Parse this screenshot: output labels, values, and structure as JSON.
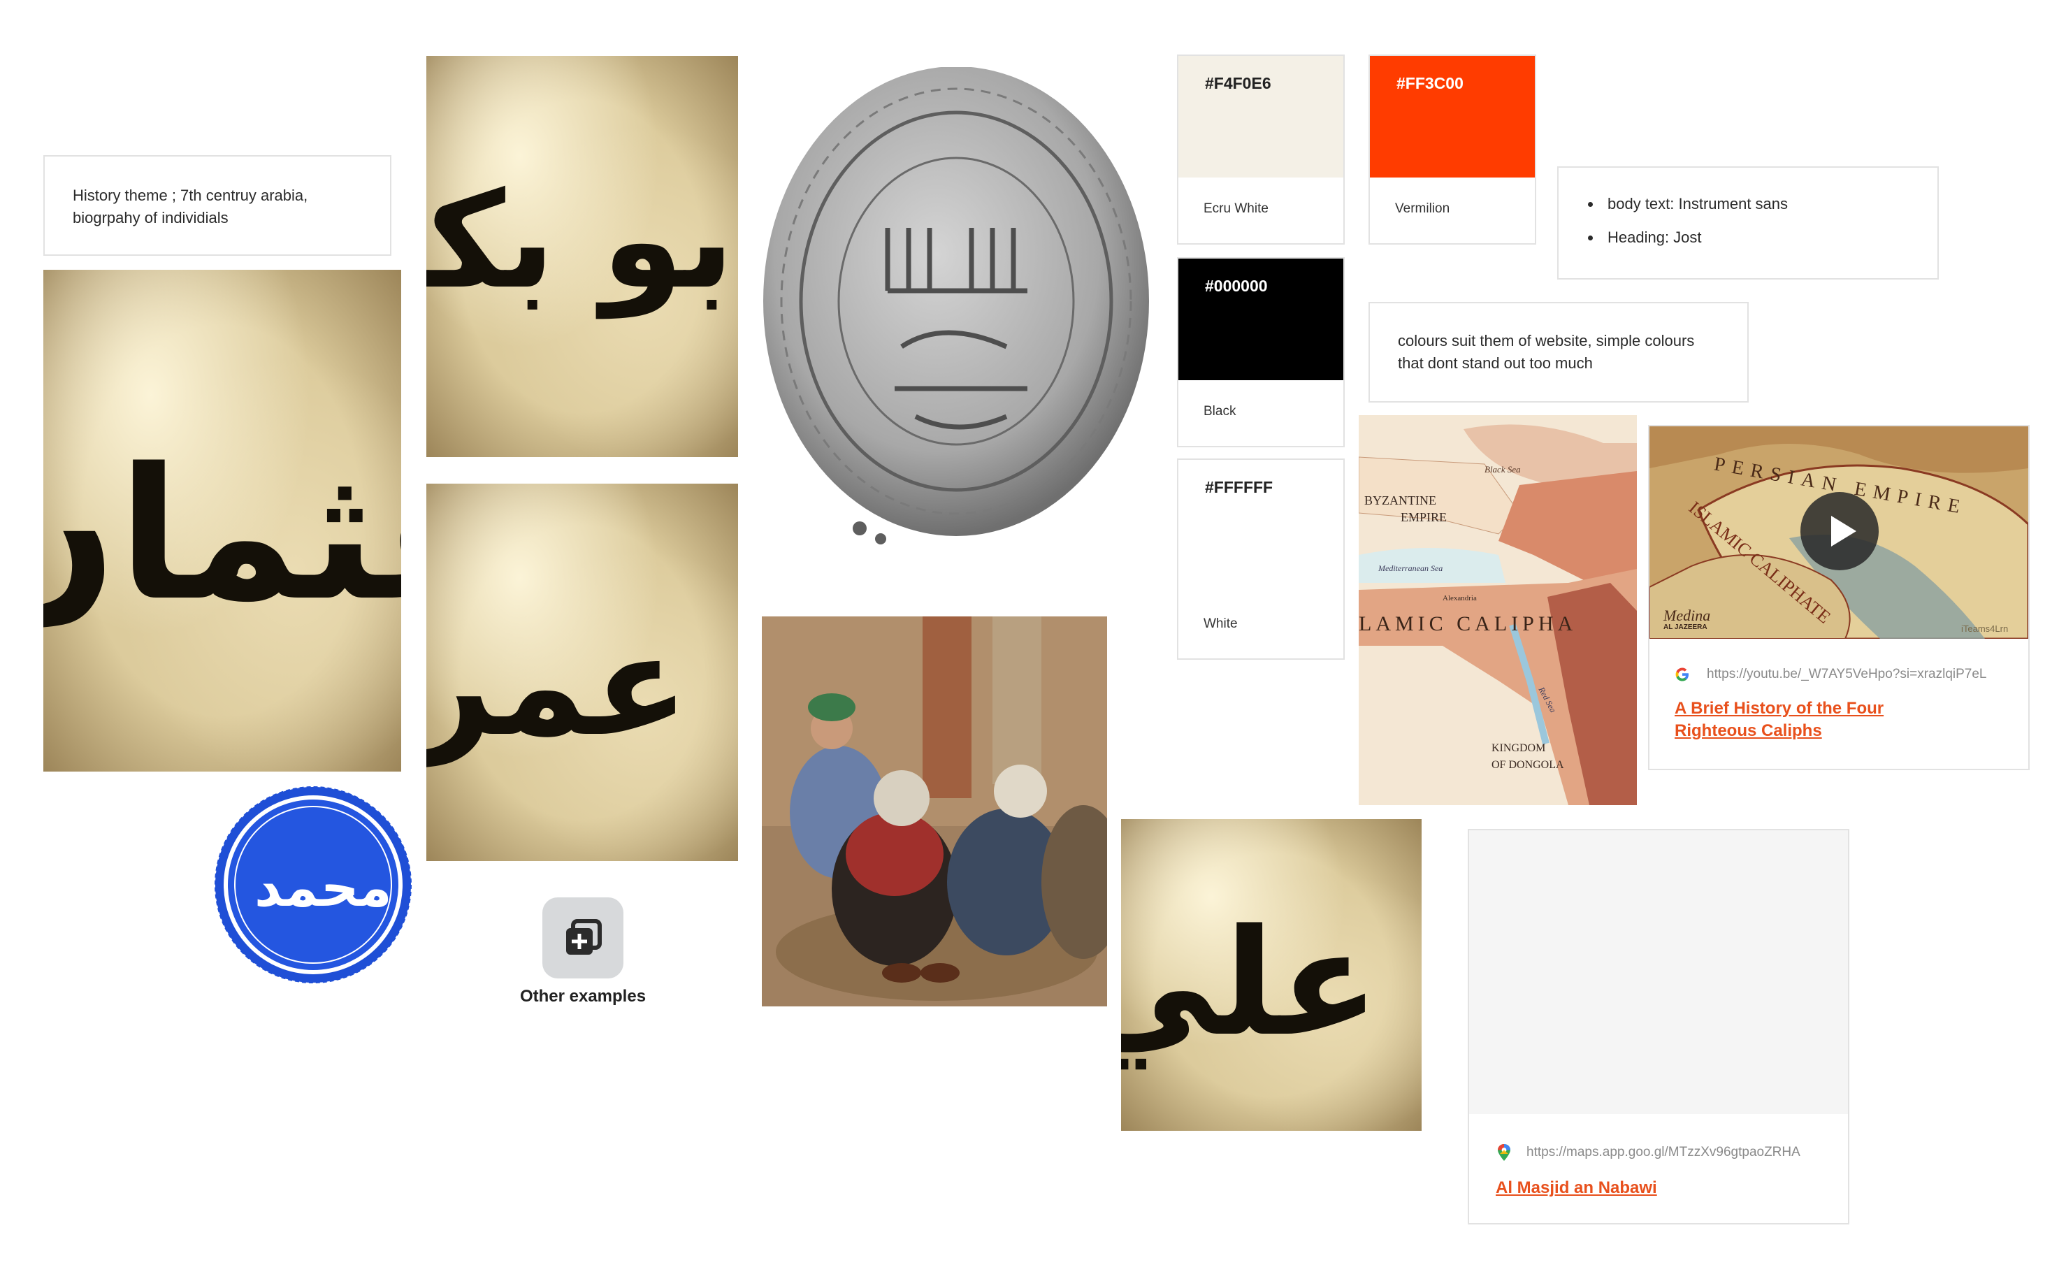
{
  "notes": {
    "theme_line1": "History theme ; 7th centruy arabia,",
    "theme_line2": "biogrpahy of individials",
    "fonts_body": "body text: Instrument sans",
    "fonts_heading": "Heading: Jost",
    "colours_line1": "colours suit them of website, simple colours",
    "colours_line2": "that dont stand out too much"
  },
  "swatches": [
    {
      "hex": "#F4F0E6",
      "name": "Ecru White",
      "color": "#F4F0E6",
      "text_color": "#222222"
    },
    {
      "hex": "#FF3C00",
      "name": "Vermilion",
      "color": "#FF3C00",
      "text_color": "#FFFFFF"
    },
    {
      "hex": "#000000",
      "name": "Black",
      "color": "#000000",
      "text_color": "#FFFFFF"
    },
    {
      "hex": "#FFFFFF",
      "name": "White",
      "color": "#FFFFFF",
      "text_color": "#222222"
    }
  ],
  "calligraphy": {
    "uthman": "عثمان",
    "abubakr": "أبو بكر",
    "umar": "عمر",
    "ali": "علي",
    "muhammad": "محمد"
  },
  "map_labels": {
    "black_sea": "Black Sea",
    "byzantine": "BYZANTINE",
    "empire": "EMPIRE",
    "mediterranean": "Mediterranean Sea",
    "islamic_caliphate": "LAMIC CALIPHA",
    "kingdom_of": "KINGDOM",
    "of_dongola": "OF DONGOLA",
    "red_sea": "Red Sea",
    "alexandria": "Alexandria"
  },
  "video": {
    "url": "https://youtu.be/_W7AY5VeHpo?si=xrazlqiP7eL",
    "title_line1": "A Brief History of the Four",
    "title_line2": "Righteous Caliphs",
    "thumb_persian": "PERSIAN EMPIRE",
    "thumb_caliphate": "ISLAMIC CALIPHATE",
    "thumb_medina": "Medina",
    "thumb_source": "AL JAZEERA",
    "thumb_brand": "iTeams4Lrn"
  },
  "maplink": {
    "url": "https://maps.app.goo.gl/MTzzXv96gtpaoZRHA",
    "title": "Al Masjid an Nabawi"
  },
  "add_caption": "Other examples",
  "accent": "#E8501C"
}
